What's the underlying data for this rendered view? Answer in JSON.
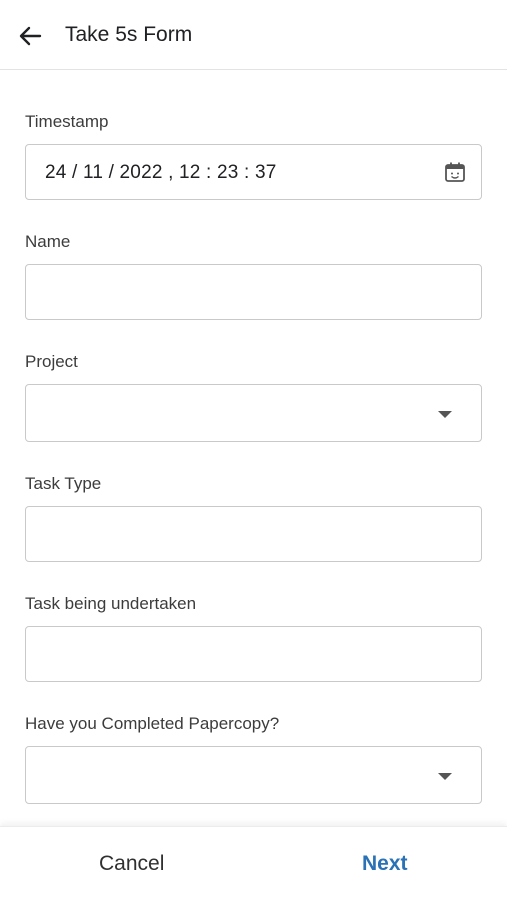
{
  "header": {
    "title": "Take 5s Form",
    "back_icon": "arrow-left-icon"
  },
  "fields": {
    "timestamp": {
      "label": "Timestamp",
      "value": "24 / 11 / 2022 ,  12 : 23 : 37",
      "icon": "calendar-icon"
    },
    "name": {
      "label": "Name",
      "value": ""
    },
    "project": {
      "label": "Project",
      "value": "",
      "icon": "caret-down-icon"
    },
    "task_type": {
      "label": "Task Type",
      "value": ""
    },
    "task_undertaken": {
      "label": "Task being undertaken",
      "value": ""
    },
    "papercopy": {
      "label": "Have you Completed Papercopy?",
      "value": "",
      "icon": "caret-down-icon"
    }
  },
  "footer": {
    "cancel_label": "Cancel",
    "next_label": "Next"
  },
  "colors": {
    "accent": "#2a72b5",
    "border": "#c9c9c9",
    "text": "#202124"
  }
}
